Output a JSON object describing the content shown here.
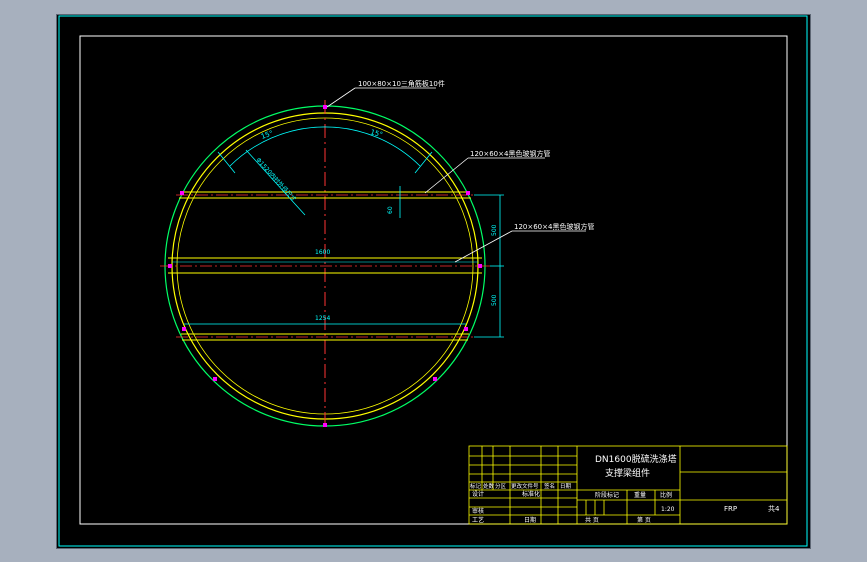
{
  "colors": {
    "background": "#a7b0be",
    "canvas": "#000000",
    "frame": "#ffffff",
    "outer_circle": "#00ff66",
    "inner_circle": "#ffff00",
    "beam": "#ffff00",
    "beam_center": "#ff3333",
    "centerline": "#ff3333",
    "dimension": "#00ffff",
    "leader": "#ffffff",
    "title_block": "#ffff00",
    "title_text": "#ffffff",
    "marker": "#ff00ff"
  },
  "annotations": {
    "triangle_plate_note": "100×80×10三角筋板10件",
    "tube_note_top": "120×60×4黑色玻钢方管",
    "tube_note_mid": "120×60×4黑色玻钢方管",
    "arc_angle_left": "15°",
    "arc_angle_right": "15°",
    "diameter_text": "Φ1520内衬外径尺寸",
    "gap_dim": "60",
    "beam_spacing_upper": "500",
    "beam_spacing_lower": "500",
    "beam_length_center": "1600",
    "beam_length_lower": "1254"
  },
  "title_block": {
    "title_line1": "DN1600脱硫洗涤塔",
    "title_line2": "支撑梁组件",
    "header_cells": [
      "标记",
      "处数",
      "分区",
      "更改文件号",
      "签名",
      "日期"
    ],
    "row_design": "设计",
    "row_standard": "标准化",
    "row_review": "审核",
    "row_process": "工艺",
    "row_approve": "日期",
    "stage_label": "阶段标记",
    "weight_label": "重量",
    "scale_label": "比例",
    "scale_value": "1:20",
    "sheet_total": "共  页",
    "sheet_no": "第  页",
    "material": "FRP",
    "count": "共4"
  }
}
